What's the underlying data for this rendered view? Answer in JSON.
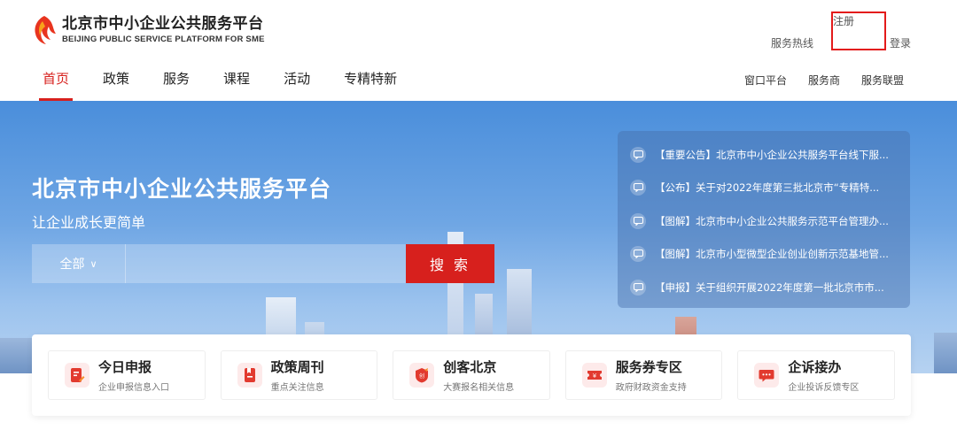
{
  "logo": {
    "name_cn": "北京市中小企业公共服务平台",
    "name_en": "BEIJING PUBLIC SERVICE PLATFORM FOR SME"
  },
  "top_links": {
    "hotline": "服务热线",
    "register": "注册",
    "login": "登录"
  },
  "nav": {
    "items": [
      {
        "label": "首页",
        "active": true
      },
      {
        "label": "政策"
      },
      {
        "label": "服务"
      },
      {
        "label": "课程"
      },
      {
        "label": "活动"
      },
      {
        "label": "专精特新"
      }
    ],
    "right": [
      "窗口平台",
      "服务商",
      "服务联盟"
    ]
  },
  "hero": {
    "title": "北京市中小企业公共服务平台",
    "subtitle": "让企业成长更简单"
  },
  "search": {
    "scope": "全部",
    "placeholder": "",
    "button": "搜 索"
  },
  "notices": [
    "【重要公告】北京市中小企业公共服务平台线下服...",
    "【公布】关于对2022年度第三批北京市“专精特...",
    "【图解】北京市中小企业公共服务示范平台管理办...",
    "【图解】北京市小型微型企业创业创新示范基地管...",
    "【申报】关于组织开展2022年度第一批北京市市..."
  ],
  "cards": [
    {
      "title": "今日申报",
      "desc": "企业申报信息入口",
      "icon": "edit-doc-icon"
    },
    {
      "title": "政策周刊",
      "desc": "重点关注信息",
      "icon": "bookmark-doc-icon"
    },
    {
      "title": "创客北京",
      "desc": "大赛报名相关信息",
      "icon": "maker-badge-icon"
    },
    {
      "title": "服务券专区",
      "desc": "政府财政资金支持",
      "icon": "yuan-ticket-icon"
    },
    {
      "title": "企诉接办",
      "desc": "企业投诉反馈专区",
      "icon": "chat-bubble-icon"
    }
  ],
  "colors": {
    "accent": "#d7201d",
    "hero": "#5a98e0"
  }
}
